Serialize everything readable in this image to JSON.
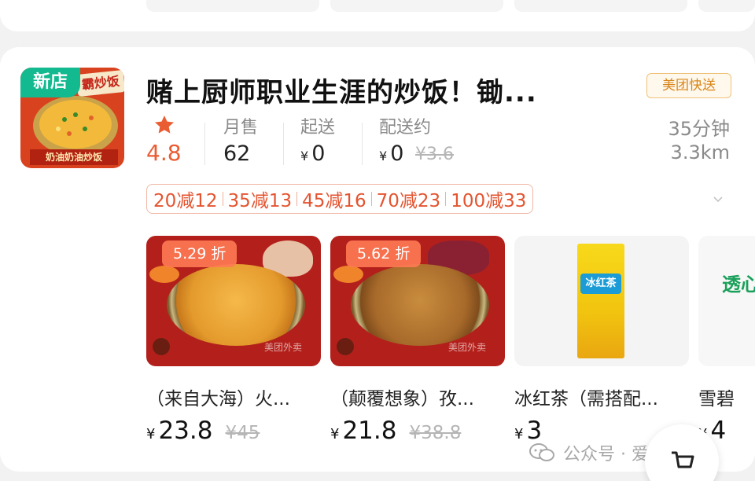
{
  "store": {
    "badge": "新店",
    "thumb_title": "霸炒饭",
    "thumb_bottom": "奶油奶油炒饭",
    "name": "赌上厨师职业生涯的炒饭！锄...",
    "delivery_tag": "美团快送",
    "rating": "4.8",
    "stats": [
      {
        "label": "月售",
        "value": "62"
      },
      {
        "label": "起送",
        "yen": "¥",
        "value": "0"
      },
      {
        "label": "配送约",
        "yen": "¥",
        "value": "0",
        "original": "¥3.6"
      }
    ],
    "eta": "35分钟",
    "distance": "3.3km",
    "promos": [
      "20减12",
      "35减13",
      "45减16",
      "70减23",
      "100减33"
    ]
  },
  "products": [
    {
      "discount": "5.29 折",
      "name": "（来自大海）火...",
      "yen": "¥",
      "price": "23.8",
      "original": "¥45",
      "watermark": "美团外卖"
    },
    {
      "discount": "5.62 折",
      "name": "（颠覆想象）孜...",
      "yen": "¥",
      "price": "21.8",
      "original": "¥38.8",
      "watermark": "美团外卖"
    },
    {
      "name": "冰红茶（需搭配...",
      "yen": "¥",
      "price": "3",
      "carton_label": "冰红茶"
    },
    {
      "name": "雪碧",
      "yen": "¥",
      "price": "4",
      "image_text": "透心凉"
    }
  ],
  "watermark": {
    "text": "公众号 · 爱德华说"
  },
  "colors": {
    "accent": "#ea5c32",
    "new_badge": "#13b98f",
    "delivery_tag": "#d8861a"
  },
  "icons": {
    "star": "star-icon",
    "expand": "chevron-down-icon",
    "cart": "cart-icon",
    "wechat": "wechat-icon"
  }
}
